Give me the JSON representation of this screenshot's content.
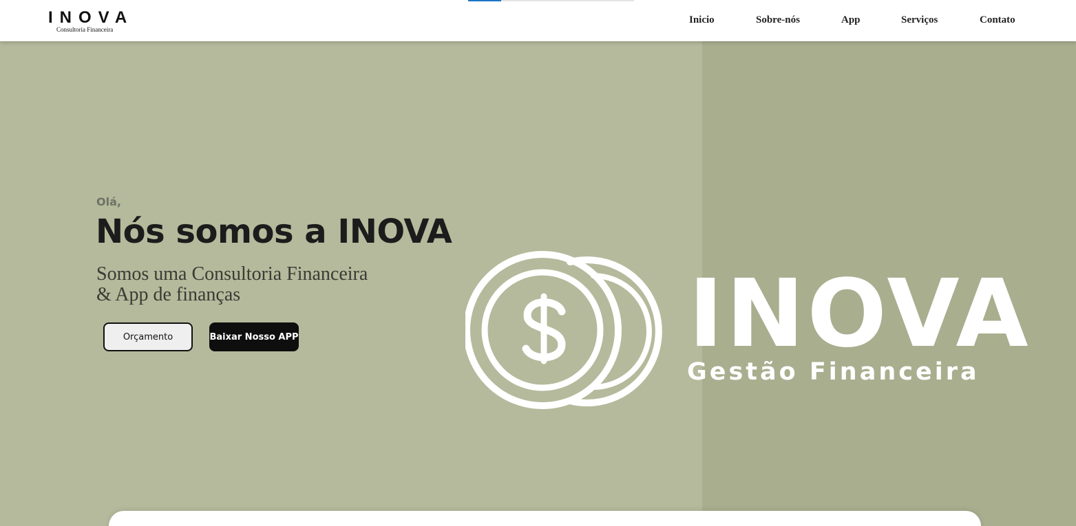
{
  "header": {
    "logo": {
      "title": "INOVA",
      "subtitle": "Consultoria Financeira"
    },
    "scroll_progress": 0.2,
    "nav": [
      {
        "label": "Inicio"
      },
      {
        "label": "Sobre-nós"
      },
      {
        "label": "App"
      },
      {
        "label": "Serviços"
      },
      {
        "label": "Contato"
      }
    ]
  },
  "hero": {
    "greeting": "Olá,",
    "headline": "Nós somos a INOVA",
    "subline_1": "Somos uma Consultoria Financeira",
    "subline_2": "& App de finanças",
    "buttons": {
      "quote": "Orçamento",
      "download": "Baixar Nosso APP"
    },
    "brand_art": {
      "name": "INOVA",
      "tagline": "Gestão Financeira",
      "icon": "dollar-coins-icon"
    }
  },
  "colors": {
    "hero_bg": "#b4ba9b",
    "hero_right_bg": "#a9ae8f",
    "progress": "#1c74c7"
  }
}
